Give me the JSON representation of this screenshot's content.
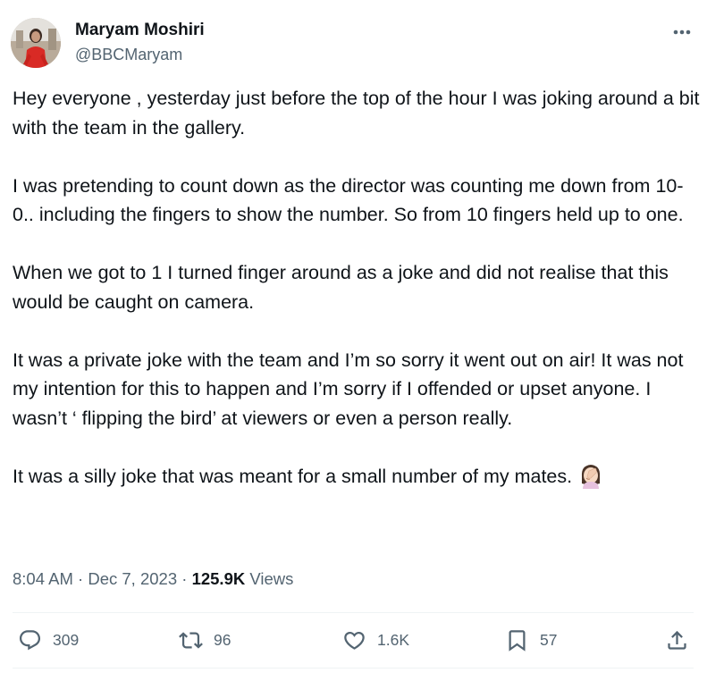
{
  "author": {
    "display_name": "Maryam Moshiri",
    "handle": "@BBCMaryam"
  },
  "tweet": {
    "paragraphs": [
      "Hey everyone , yesterday just before the top of the hour I was joking around a bit with the team in the gallery.",
      "I was pretending to count down as the director was counting me down from 10-0.. including the fingers to show the number. So from 10 fingers held up to one.",
      "When we got to 1 I turned finger around as a joke and did not realise that this would be caught on camera.",
      "It was a private joke with the team and I’m so sorry it went out on air! It was not my intention for this to happen and I’m sorry if I offended or upset anyone. I wasn’t ‘ flipping the bird’ at viewers or even a person really.",
      "It was a silly joke that was meant for a small number of my mates."
    ],
    "emoji": "woman-facepalming-emoji"
  },
  "meta": {
    "time": "8:04 AM",
    "separator": " · ",
    "date": "Dec 7, 2023",
    "views_count": "125.9K",
    "views_label": " Views"
  },
  "actions": {
    "replies": "309",
    "reposts": "96",
    "likes": "1.6K",
    "bookmarks": "57"
  },
  "colors": {
    "text": "#0f1419",
    "secondary": "#536471",
    "divider": "#eff3f4"
  }
}
